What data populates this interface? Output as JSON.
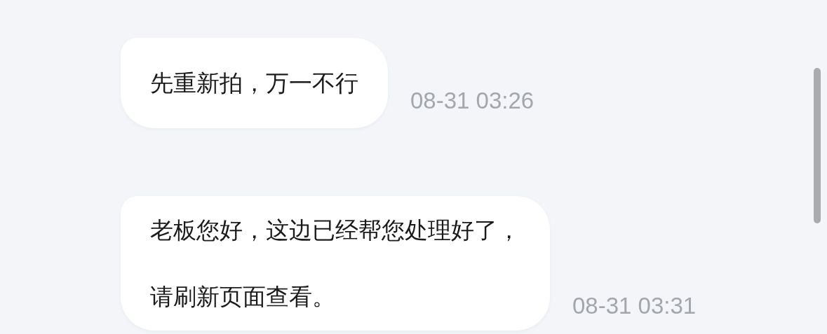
{
  "messages": [
    {
      "lines": [
        "先重新拍，万一不行"
      ],
      "time": "08-31 03:26"
    },
    {
      "lines": [
        "老板您好，这边已经帮您处理好了，",
        "请刷新页面查看。"
      ],
      "time": "08-31 03:31"
    }
  ]
}
